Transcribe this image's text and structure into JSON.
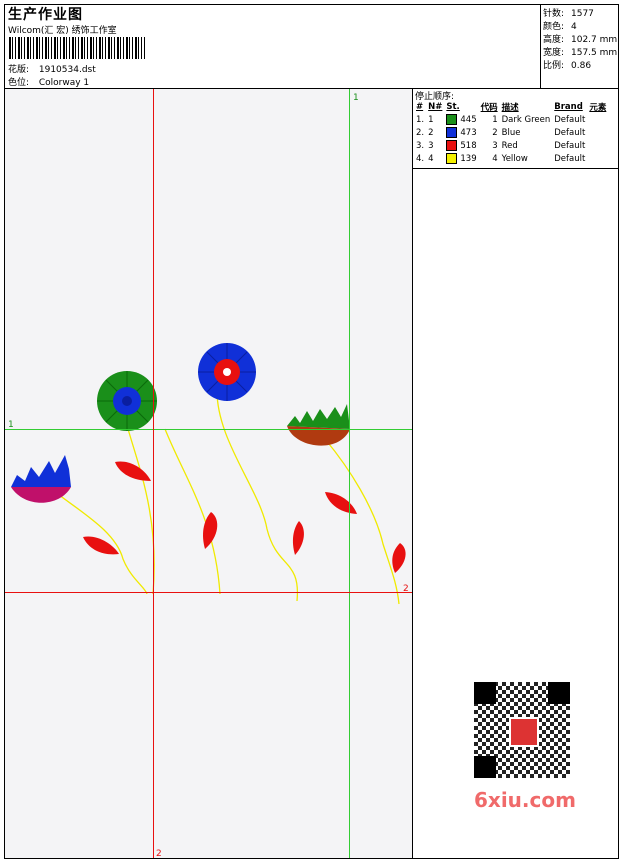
{
  "header": {
    "title": "生产作业图",
    "company": "Wilcom(汇 宏) 绣饰工作室",
    "design_label": "花版:",
    "design_value": "1910534.dst",
    "colorway_label": "色位:",
    "colorway_value": "Colorway 1"
  },
  "stats": [
    {
      "label": "针数:",
      "value": "1577"
    },
    {
      "label": "颜色:",
      "value": "4"
    },
    {
      "label": "高度:",
      "value": "102.7 mm"
    },
    {
      "label": "宽度:",
      "value": "157.5 mm"
    },
    {
      "label": "比例:",
      "value": "0.86"
    }
  ],
  "stop_sequence": {
    "title": "停止顺序:",
    "columns": [
      "#",
      "N#",
      "St.",
      "代码",
      "描述",
      "Brand",
      "元素"
    ],
    "rows": [
      {
        "num": "1.",
        "n": "1",
        "color": "#1a8f1a",
        "st": "445",
        "code": "1",
        "desc": "Dark Green",
        "brand": "Default"
      },
      {
        "num": "2.",
        "n": "2",
        "color": "#1030d8",
        "st": "473",
        "code": "2",
        "desc": "Blue",
        "brand": "Default"
      },
      {
        "num": "3.",
        "n": "3",
        "color": "#e81010",
        "st": "518",
        "code": "3",
        "desc": "Red",
        "brand": "Default"
      },
      {
        "num": "4.",
        "n": "4",
        "color": "#f4f000",
        "st": "139",
        "code": "4",
        "desc": "Yellow",
        "brand": "Default"
      }
    ]
  },
  "guides": {
    "green_label_top": "1",
    "green_label_left": "1",
    "red_label_right": "2",
    "red_label_bottom": "2"
  },
  "watermark": "6xiu.com"
}
